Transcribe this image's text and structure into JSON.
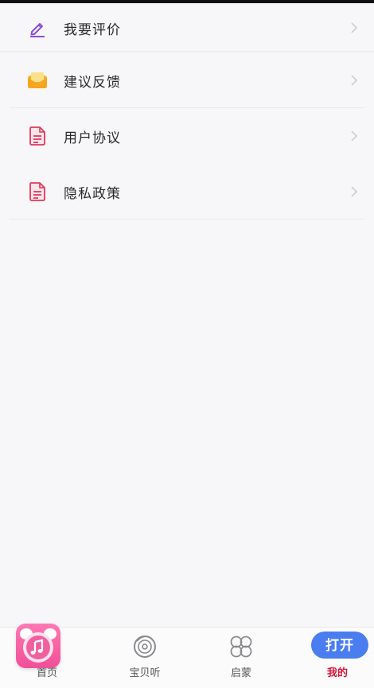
{
  "menu": {
    "items": [
      {
        "label": "我要评价",
        "icon": "pencil-icon"
      },
      {
        "label": "建议反馈",
        "icon": "envelope-icon"
      },
      {
        "label": "用户协议",
        "icon": "document-icon"
      },
      {
        "label": "隐私政策",
        "icon": "document-icon"
      }
    ]
  },
  "tabbar": {
    "tabs": [
      {
        "label": "首页",
        "icon": "home-icon",
        "active": false
      },
      {
        "label": "宝贝听",
        "icon": "disc-icon",
        "active": false
      },
      {
        "label": "启蒙",
        "icon": "clover-icon",
        "active": false
      },
      {
        "label": "我的",
        "icon": "profile-icon",
        "active": true
      }
    ]
  },
  "banner": {
    "app_icon": "alarm-clock-music-icon",
    "open_label": "打开"
  },
  "colors": {
    "accent_active": "#d0183a",
    "open_button": "#4a7ef0",
    "pencil": "#8a4fd8",
    "envelope": "#f4b12f",
    "document": "#e0395a",
    "app_icon": "#f04f98"
  }
}
